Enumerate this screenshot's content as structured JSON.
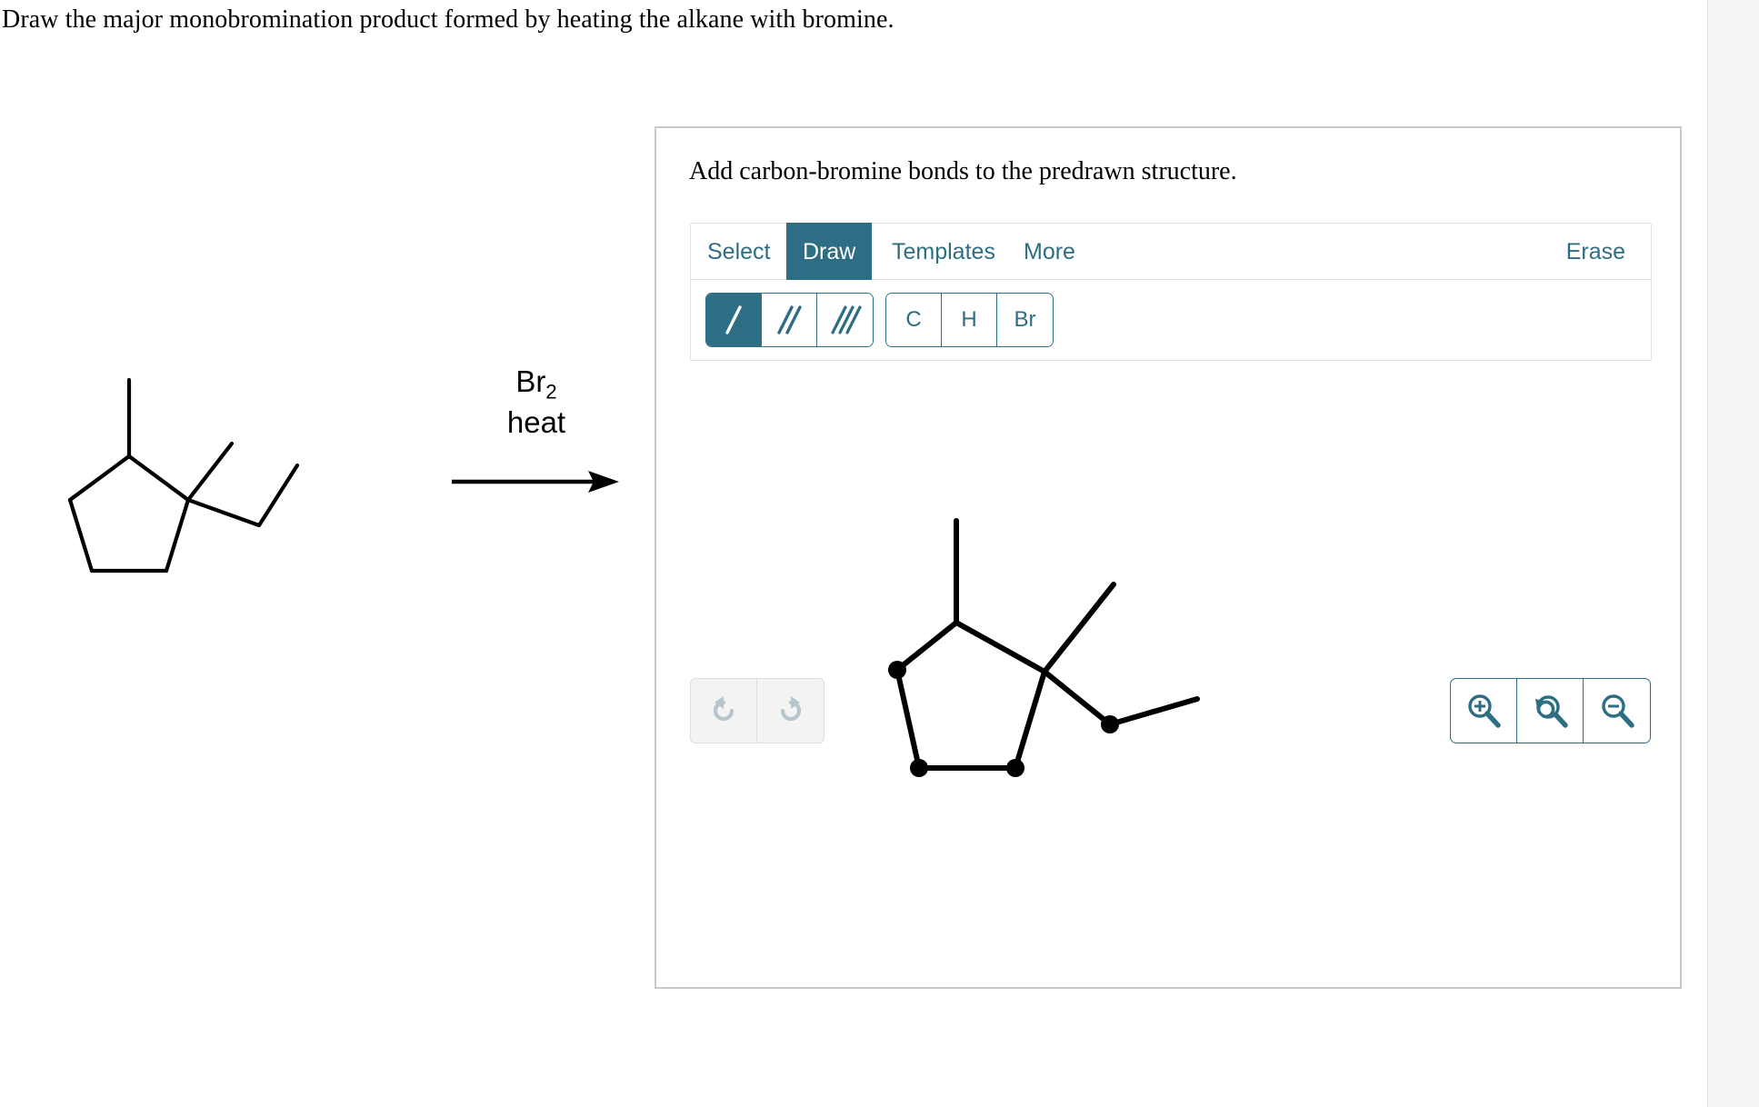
{
  "prompt": "Draw the major monobromination product formed by heating the alkane with bromine.",
  "reaction": {
    "arrow_label_top": "Br",
    "arrow_label_top_sub": "2",
    "arrow_label_bottom": "heat",
    "arrow_icon": "reaction-arrow-right",
    "reactant_name": "1,1,2-trisubstituted-cyclopentane-skeletal-structure"
  },
  "editor": {
    "instruction": "Add carbon-bromine bonds to the predrawn structure.",
    "accent_color": "#2d6e85",
    "border_color": "#c9c9c9",
    "tabs": [
      {
        "label": "Select",
        "active": false
      },
      {
        "label": "Draw",
        "active": true
      },
      {
        "label": "Templates",
        "active": false
      },
      {
        "label": "More",
        "active": false
      }
    ],
    "erase_label": "Erase",
    "bond_tools": [
      {
        "name": "single-bond",
        "icon": "single-bond-icon",
        "selected": true
      },
      {
        "name": "double-bond",
        "icon": "double-bond-icon",
        "selected": false
      },
      {
        "name": "triple-bond",
        "icon": "triple-bond-icon",
        "selected": false
      }
    ],
    "atom_tools": [
      {
        "label": "C",
        "name": "carbon-atom-tool"
      },
      {
        "label": "H",
        "name": "hydrogen-atom-tool"
      },
      {
        "label": "Br",
        "name": "bromine-atom-tool"
      }
    ],
    "history_tools": [
      {
        "name": "undo-button",
        "icon": "undo-icon",
        "enabled": false
      },
      {
        "name": "redo-button",
        "icon": "redo-icon",
        "enabled": false
      }
    ],
    "zoom_tools": [
      {
        "name": "zoom-in-button",
        "icon": "zoom-in-icon"
      },
      {
        "name": "reset-zoom-button",
        "icon": "reset-zoom-icon"
      },
      {
        "name": "zoom-out-button",
        "icon": "zoom-out-icon"
      }
    ],
    "canvas": {
      "structure_name": "predrawn-cyclopentane-structure",
      "vertex_dots": 4
    }
  }
}
